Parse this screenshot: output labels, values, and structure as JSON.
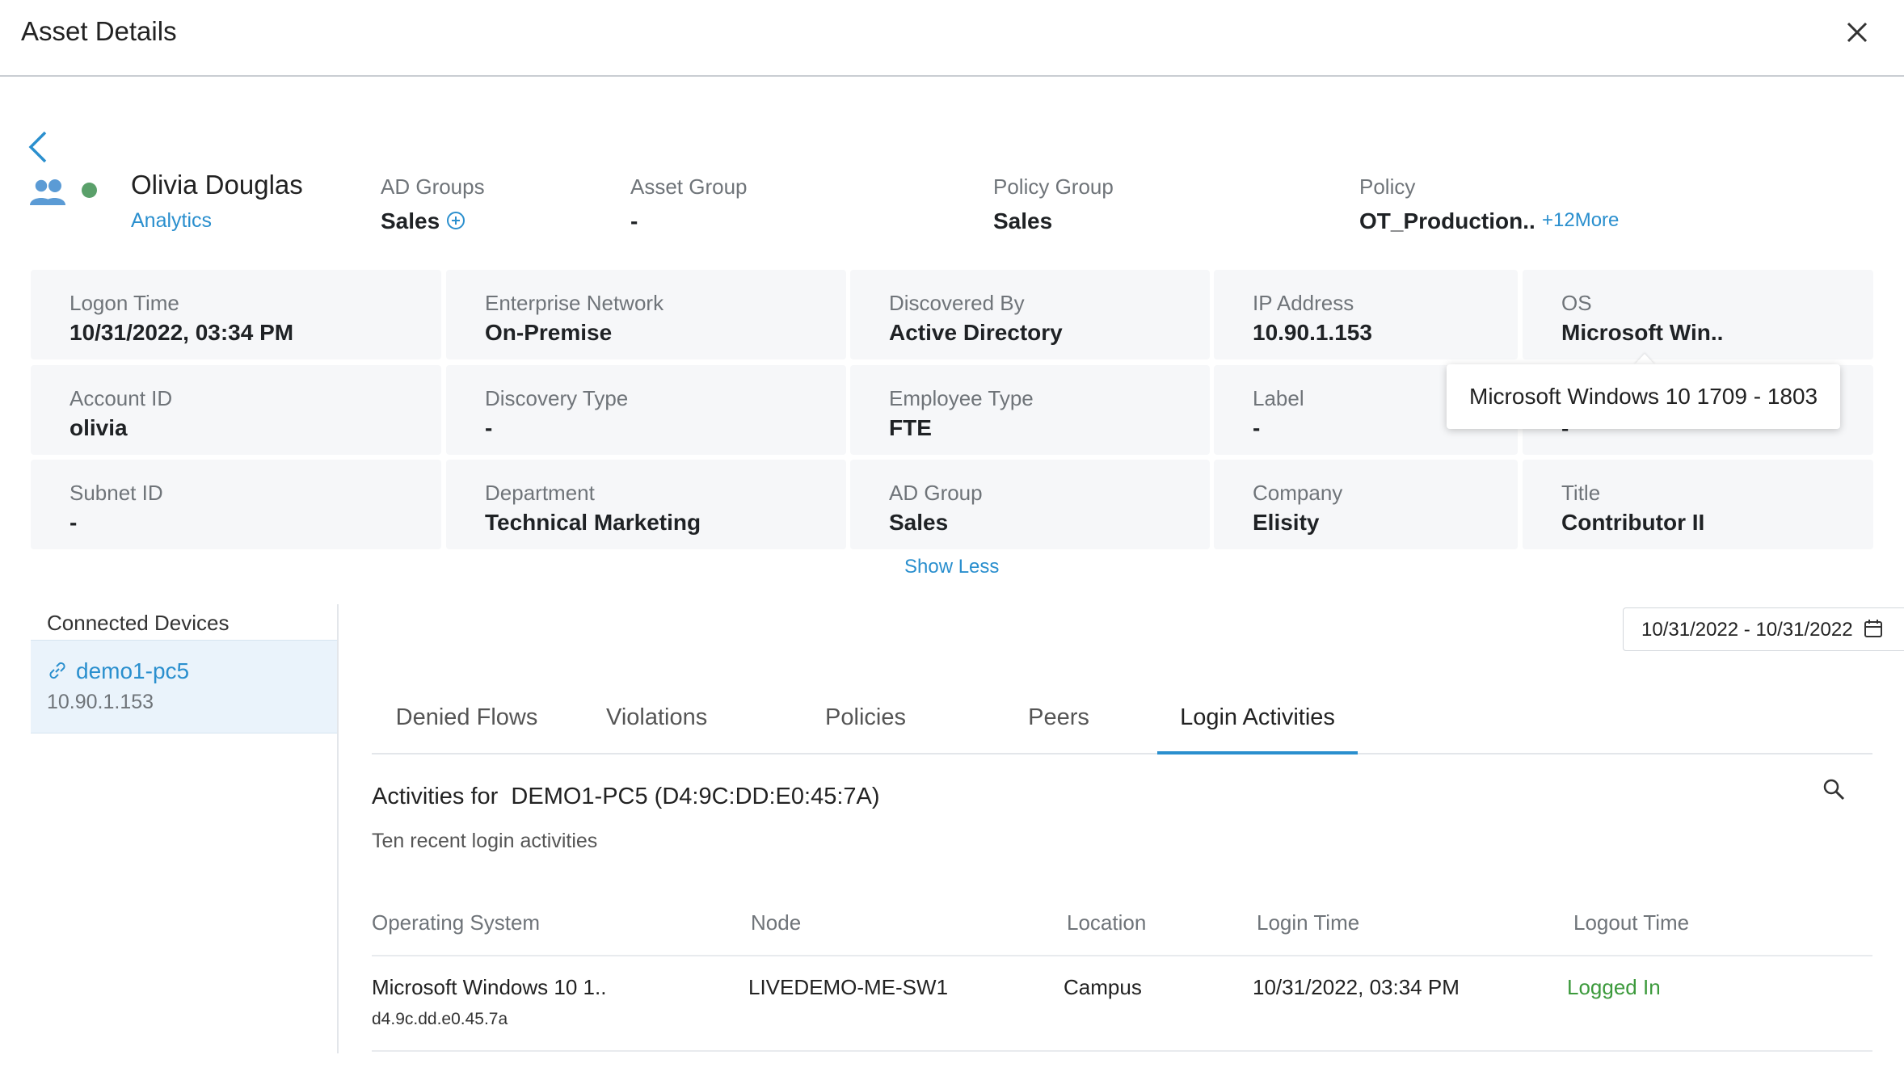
{
  "header": {
    "title": "Asset Details"
  },
  "asset": {
    "name": "Olivia Douglas",
    "link": "Analytics",
    "status_color": "#5aa06a"
  },
  "summary": {
    "ad_groups_label": "AD Groups",
    "ad_groups_value": "Sales",
    "asset_group_label": "Asset Group",
    "asset_group_value": "-",
    "policy_group_label": "Policy Group",
    "policy_group_value": "Sales",
    "policy_label": "Policy",
    "policy_value": "OT_Production..",
    "policy_more": "+12More"
  },
  "details": [
    {
      "label": "Logon Time",
      "value": "10/31/2022, 03:34 PM"
    },
    {
      "label": "Enterprise Network",
      "value": "On-Premise"
    },
    {
      "label": "Discovered By",
      "value": "Active Directory"
    },
    {
      "label": "IP Address",
      "value": "10.90.1.153"
    },
    {
      "label": "OS",
      "value": "Microsoft Win.."
    },
    {
      "label": "Account ID",
      "value": "olivia"
    },
    {
      "label": "Discovery Type",
      "value": "-"
    },
    {
      "label": "Employee Type",
      "value": "FTE"
    },
    {
      "label": "Label",
      "value": "-"
    },
    {
      "label": "",
      "value": "-"
    },
    {
      "label": "Subnet ID",
      "value": "-"
    },
    {
      "label": "Department",
      "value": "Technical Marketing"
    },
    {
      "label": "AD Group",
      "value": "Sales"
    },
    {
      "label": "Company",
      "value": "Elisity"
    },
    {
      "label": "Title",
      "value": "Contributor II"
    }
  ],
  "tooltip": "Microsoft Windows 10 1709 - 1803",
  "show_less": "Show Less",
  "devices": {
    "title": "Connected Devices",
    "items": [
      {
        "name": "demo1-pc5",
        "ip": "10.90.1.153"
      }
    ]
  },
  "date_range": "10/31/2022 - 10/31/2022",
  "tabs": [
    {
      "label": "Denied Flows",
      "active": false
    },
    {
      "label": "Violations",
      "active": false
    },
    {
      "label": "Policies",
      "active": false
    },
    {
      "label": "Peers",
      "active": false
    },
    {
      "label": "Login Activities",
      "active": true
    }
  ],
  "activities": {
    "title": "Activities for  DEMO1-PC5 (D4:9C:DD:E0:45:7A)",
    "subtitle": "Ten recent login activities",
    "columns": [
      "Operating System",
      "Node",
      "Location",
      "Login Time",
      "Logout Time"
    ],
    "rows": [
      {
        "os": "Microsoft Windows 10 1..",
        "os_sub": "d4.9c.dd.e0.45.7a",
        "node": "LIVEDEMO-ME-SW1",
        "location": "Campus",
        "login_time": "10/31/2022, 03:34 PM",
        "logout_time": "Logged In",
        "logout_color": "#3c9a3c"
      }
    ]
  },
  "colors": {
    "accent": "#2a8fce",
    "logged_in": "#3c9a3c"
  }
}
